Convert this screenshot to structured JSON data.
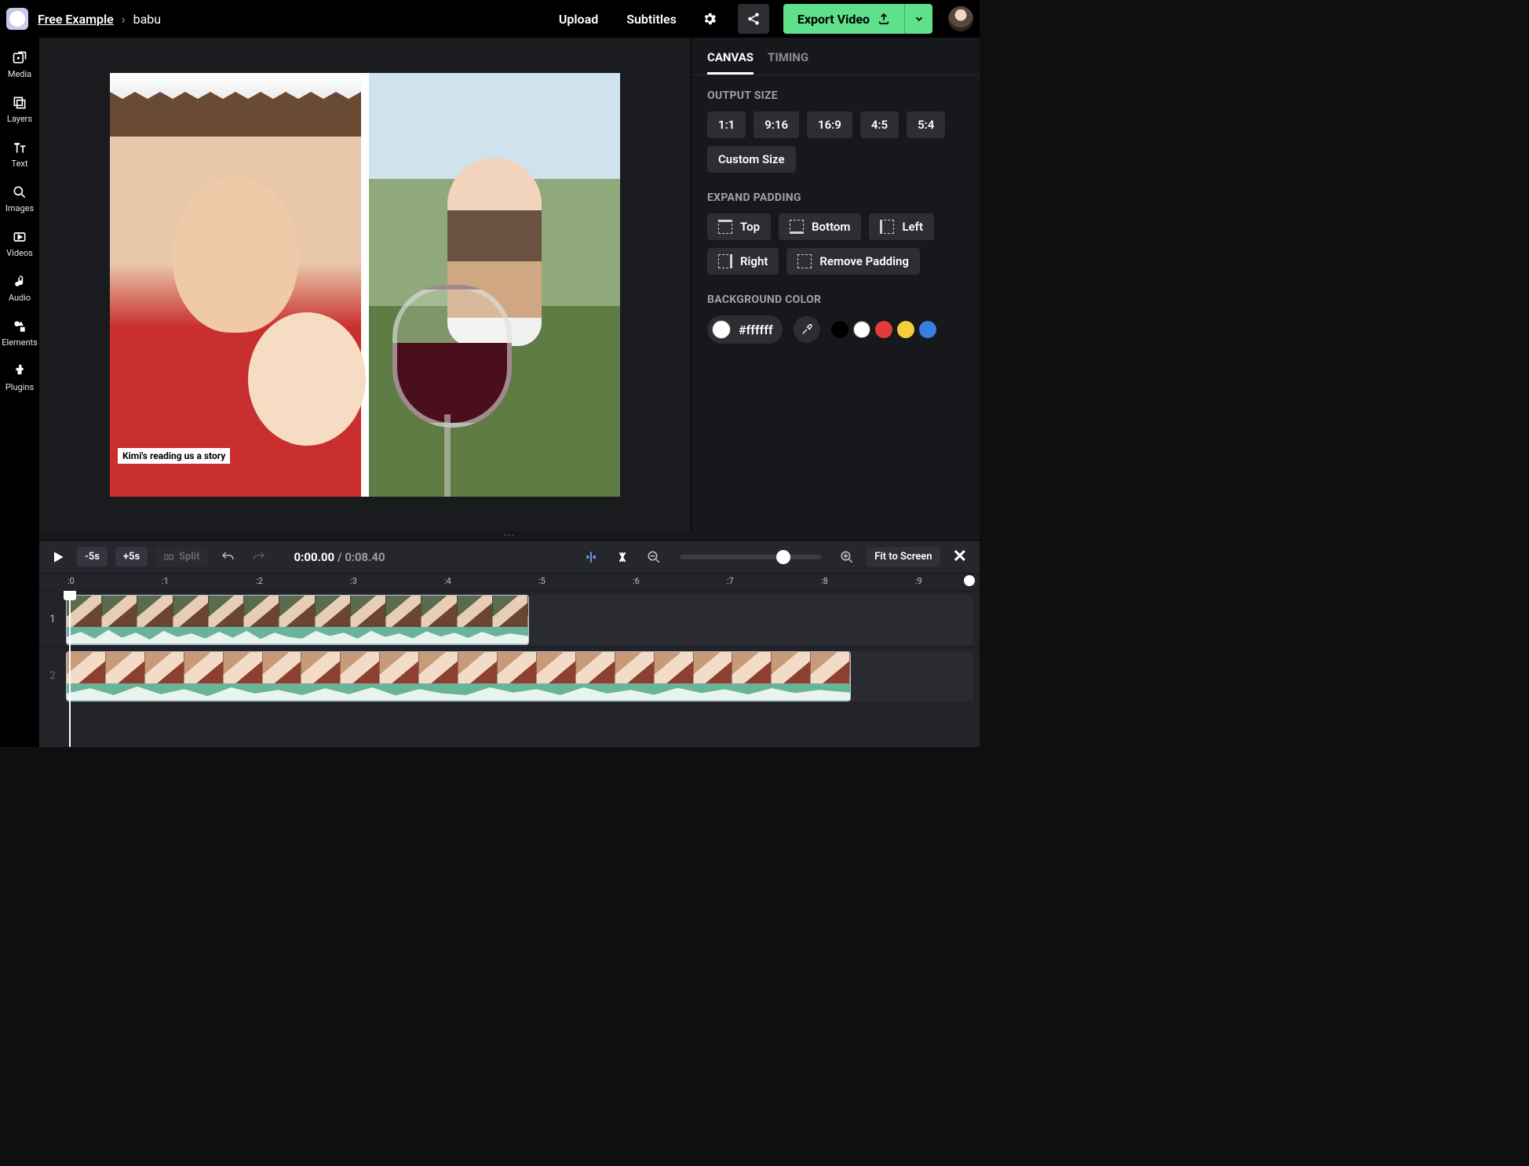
{
  "header": {
    "workspace": "Free Example",
    "separator": "›",
    "project": "babu",
    "upload": "Upload",
    "subtitles": "Subtitles",
    "export": "Export Video"
  },
  "lefttabs": {
    "media": "Media",
    "layers": "Layers",
    "text": "Text",
    "images": "Images",
    "videos": "Videos",
    "audio": "Audio",
    "elements": "Elements",
    "plugins": "Plugins"
  },
  "caption": "Kimi's reading us a story",
  "panel": {
    "tab_canvas": "CANVAS",
    "tab_timing": "TIMING",
    "output_size": "OUTPUT SIZE",
    "ratios": {
      "r1": "1:1",
      "r2": "9:16",
      "r3": "16:9",
      "r4": "4:5",
      "r5": "5:4"
    },
    "custom": "Custom Size",
    "expand": "EXPAND PADDING",
    "top": "Top",
    "bottom": "Bottom",
    "left": "Left",
    "right": "Right",
    "remove": "Remove Padding",
    "bgcolor": "BACKGROUND COLOR",
    "hex": "#ffffff",
    "presets": [
      "#000000",
      "#ffffff",
      "#e23b3b",
      "#f4cf3a",
      "#3a7de0"
    ]
  },
  "tl": {
    "back5": "-5s",
    "fwd5": "+5s",
    "split": "Split",
    "cur": "0:00.00",
    "sep": " / ",
    "dur": "0:08.40",
    "fit": "Fit to Screen",
    "ticks": [
      ":0",
      ":1",
      ":2",
      ":3",
      ":4",
      ":5",
      ":6",
      ":7",
      ":8",
      ":9"
    ],
    "track1": "1",
    "track2": "2"
  }
}
